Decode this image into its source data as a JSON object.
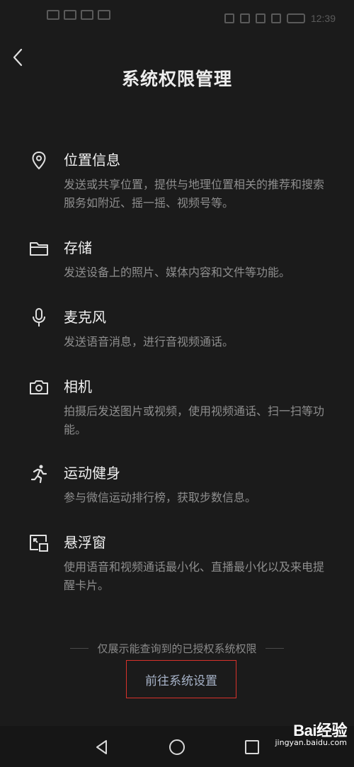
{
  "status_bar": {
    "time": "12:39"
  },
  "header": {
    "title": "系统权限管理",
    "back_icon": "chevron-left-icon"
  },
  "permissions": [
    {
      "icon": "location-pin-icon",
      "name": "位置信息",
      "desc": "发送或共享位置，提供与地理位置相关的推荐和搜索服务如附近、摇一摇、视频号等。"
    },
    {
      "icon": "folder-icon",
      "name": "存储",
      "desc": "发送设备上的照片、媒体内容和文件等功能。"
    },
    {
      "icon": "microphone-icon",
      "name": "麦克风",
      "desc": "发送语音消息，进行音视频通话。"
    },
    {
      "icon": "camera-icon",
      "name": "相机",
      "desc": "拍摄后发送图片或视频，使用视频通话、扫一扫等功能。"
    },
    {
      "icon": "running-person-icon",
      "name": "运动健身",
      "desc": "参与微信运动排行榜，获取步数信息。"
    },
    {
      "icon": "floating-window-icon",
      "name": "悬浮窗",
      "desc": "使用语音和视频通话最小化、直播最小化以及来电提醒卡片。"
    }
  ],
  "footer": {
    "note": "仅展示能查询到的已授权系统权限",
    "link_label": "前往系统设置"
  },
  "watermark": {
    "brand": "Bai经验",
    "url": "jingyan.baidu.com"
  },
  "colors": {
    "background": "#1b1b1b",
    "link": "#a7b3c8",
    "highlight_border": "#d8322b"
  }
}
